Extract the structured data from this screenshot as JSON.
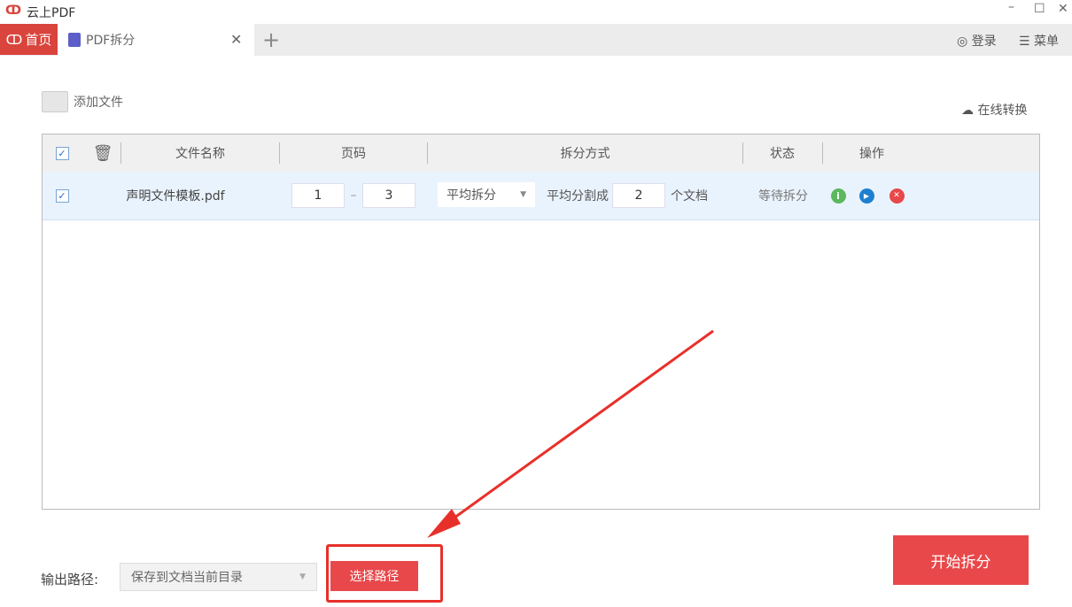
{
  "app": {
    "title": "云上PDF",
    "home_tab": "首页",
    "active_tab": "PDF拆分",
    "login": "登录",
    "menu": "菜单"
  },
  "toolbar": {
    "add_file": "添加文件",
    "online_convert": "在线转换"
  },
  "table": {
    "headers": [
      "文件名称",
      "页码",
      "拆分方式",
      "状态",
      "操作"
    ],
    "rows": [
      {
        "checked": true,
        "filename": "声明文件模板.pdf",
        "page_from": "1",
        "page_dash": "–",
        "page_to": "3",
        "split_mode": "平均拆分",
        "split_label": "平均分割成",
        "split_count": "2",
        "split_unit": "个文档",
        "status": "等待拆分"
      }
    ]
  },
  "footer": {
    "output_label": "输出路径:",
    "output_value": "保存到文档当前目录",
    "choose_path": "选择路径",
    "start": "开始拆分"
  },
  "colors": {
    "accent": "#e8484a",
    "info": "#5cb85c",
    "play": "#1e7fd0",
    "remove": "#e8484a"
  }
}
